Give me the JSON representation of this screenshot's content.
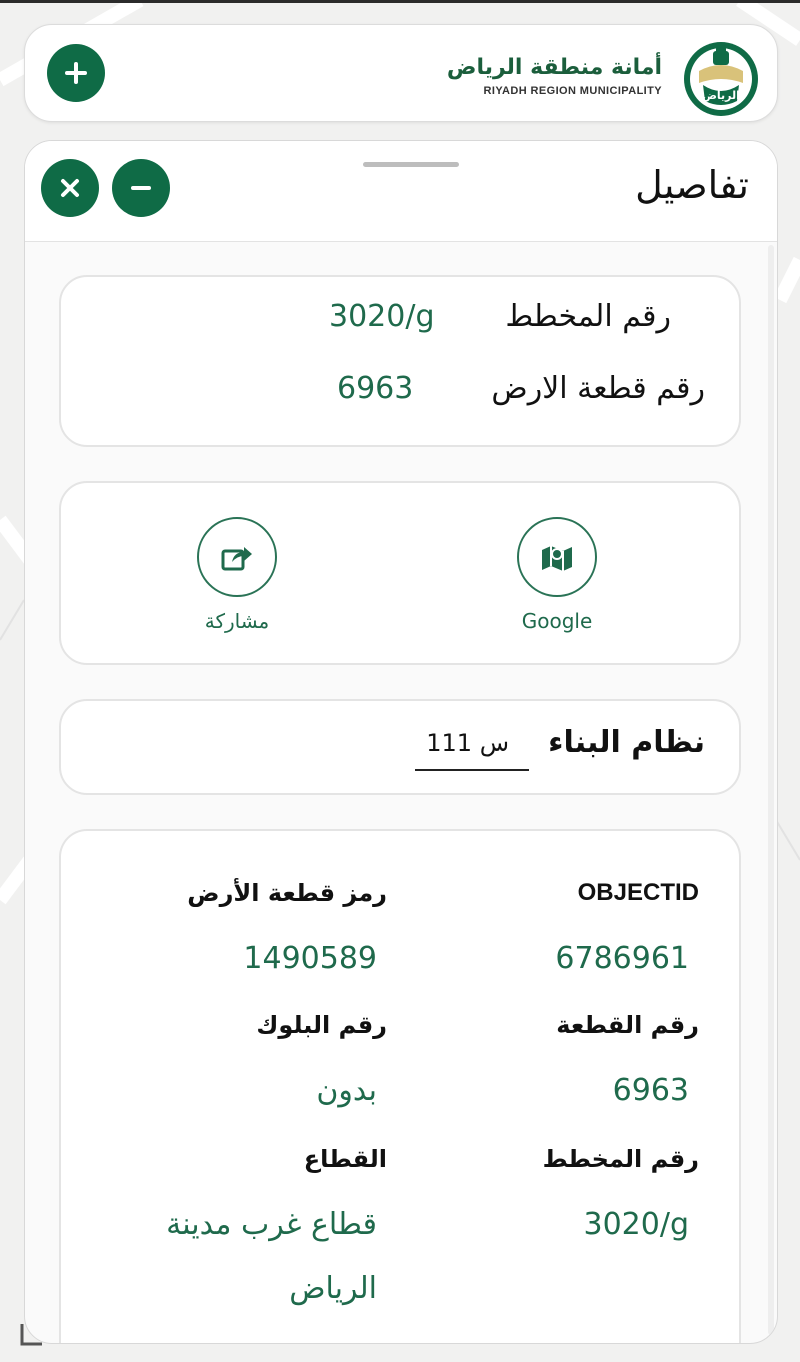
{
  "header": {
    "brand_ar": "أمانة منطقة الرياض",
    "brand_en": "RIYADH REGION MUNICIPALITY",
    "logo_text": "الرياض",
    "add_icon": "plus-icon"
  },
  "panel": {
    "title": "تفاصيل",
    "close_icon": "close-icon",
    "minimize_icon": "minus-icon"
  },
  "summary": {
    "plan_label": "رقم المخطط",
    "plan_value": "3020/g",
    "parcel_label": "رقم قطعة الارض",
    "parcel_value": "6963"
  },
  "actions": {
    "google_label": "Google",
    "google_icon": "map-icon",
    "share_label": "مشاركة",
    "share_icon": "share-icon"
  },
  "building": {
    "label": "نظام البناء",
    "value": "س 111"
  },
  "attributes": {
    "objectid_label": "OBJECTID",
    "objectid_value": "6786961",
    "parcel_code_label": "رمز قطعة الأرض",
    "parcel_code_value": "1490589",
    "parcel_no_label": "رقم القطعة",
    "parcel_no_value": "6963",
    "block_label": "رقم البلوك",
    "block_value": "بدون",
    "plan_no_label": "رقم المخطط",
    "plan_no_value": "3020/g",
    "sector_label": "القطاع",
    "sector_value_line1": "قطاع غرب مدينة",
    "sector_value_line2": "الرياض"
  },
  "colors": {
    "brand_green": "#0f6b46",
    "value_green": "#1f6a4c"
  }
}
